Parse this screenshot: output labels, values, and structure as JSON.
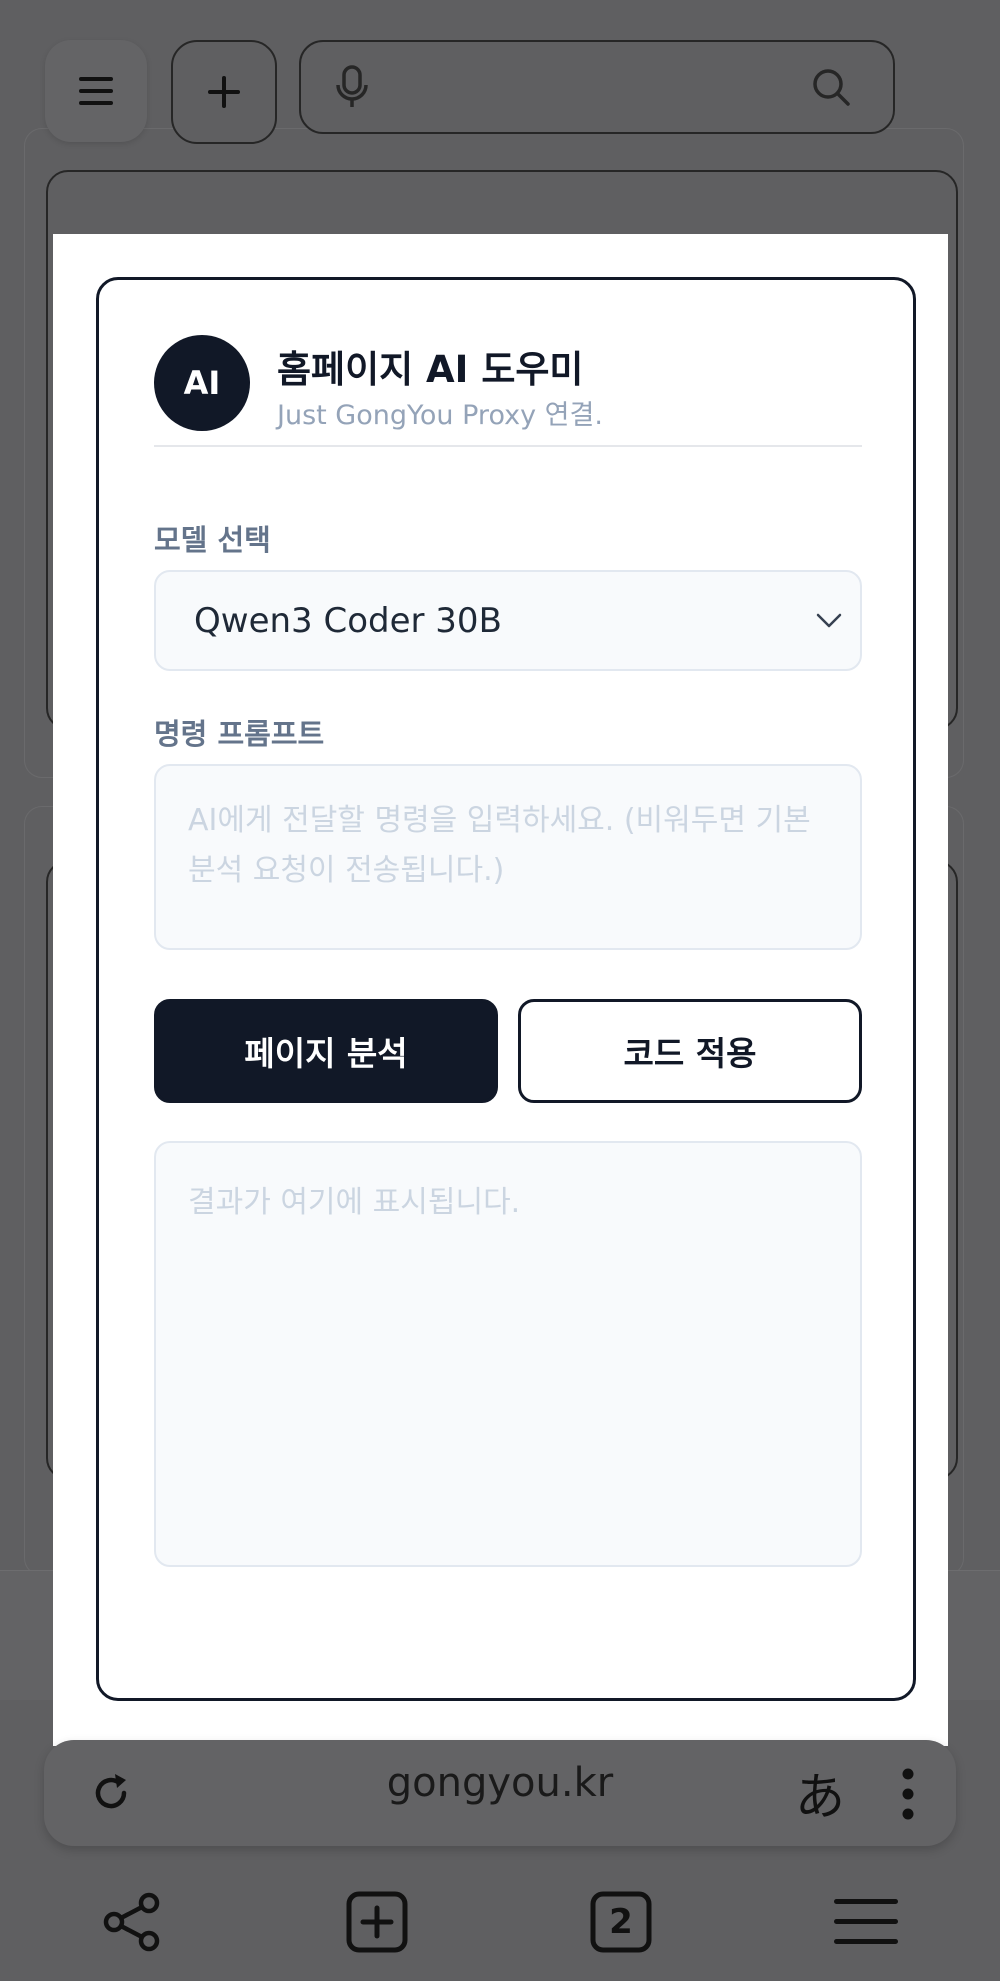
{
  "modal": {
    "avatar_text": "AI",
    "title": "홈페이지 AI 도우미",
    "subtitle": "Just GongYou Proxy 연결.",
    "model_label": "모델 선택",
    "model_selected": "Qwen3 Coder 30B",
    "prompt_label": "명령 프롬프트",
    "prompt_placeholder": "AI에게 전달할 명령을 입력하세요. (비워두면 기본 분석 요청이 전송됩니다.)",
    "analyze_button": "페이지 분석",
    "apply_button": "코드 적용",
    "result_placeholder": "결과가 여기에 표시됩니다."
  },
  "browser": {
    "url": "gongyou.kr",
    "translate_glyph": "あ",
    "tab_count": "2"
  },
  "colors": {
    "primary": "#111827",
    "input_bg": "#f8fafc",
    "input_border": "#e2e8f0",
    "muted_text": "#94a3b8",
    "placeholder": "#cbd5e1",
    "scrim": "#5f5f61"
  }
}
